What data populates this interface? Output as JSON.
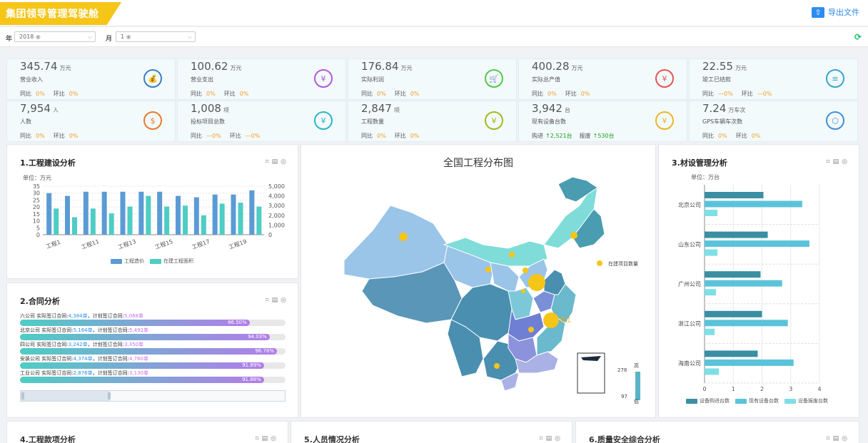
{
  "app": {
    "title": "集团领导管理驾驶舱",
    "export_label": "导出文件"
  },
  "filters": {
    "year_label": "年",
    "year_value": "2018",
    "month_label": "月",
    "month_value": "1"
  },
  "kpis": [
    {
      "value": "345.74",
      "unit": "万元",
      "label": "营业收入",
      "yoy_label": "同比",
      "yoy": "0%",
      "mom_label": "环比",
      "mom": "0%",
      "icon": "money-bag-icon",
      "color": "#3a7fc4"
    },
    {
      "value": "100.62",
      "unit": "万元",
      "label": "营业支出",
      "yoy_label": "同比",
      "yoy": "0%",
      "mom_label": "环比",
      "mom": "0%",
      "icon": "yen-circle-icon",
      "color": "#b25ad6"
    },
    {
      "value": "176.84",
      "unit": "万元",
      "label": "实际利润",
      "yoy_label": "同比",
      "yoy": "0%",
      "mom_label": "环比",
      "mom": "0%",
      "icon": "cart-icon",
      "color": "#55c94a"
    },
    {
      "value": "400.28",
      "unit": "万元",
      "label": "实际总产值",
      "yoy_label": "同比",
      "yoy": "0%",
      "mom_label": "环比",
      "mom": "0%",
      "icon": "banknote-icon",
      "color": "#e4554f"
    },
    {
      "value": "22.55",
      "unit": "万元",
      "label": "竣工已结款",
      "yoy_label": "同比",
      "yoy": "—0%",
      "mom_label": "环比",
      "mom": "—0%",
      "icon": "clipboard-icon",
      "color": "#3aa6c9"
    },
    {
      "value": "7,954",
      "unit": "人",
      "label": "人数",
      "yoy_label": "同比",
      "yoy": "0%",
      "mom_label": "环比",
      "mom": "0%",
      "icon": "dollar-house-icon",
      "color": "#e87a2e"
    },
    {
      "value": "1,008",
      "unit": "项",
      "label": "投标项目总数",
      "yoy_label": "同比",
      "yoy": "—0%",
      "mom_label": "环比",
      "mom": "—0%",
      "icon": "tag-icon",
      "color": "#2bb5c9"
    },
    {
      "value": "2,847",
      "unit": "项",
      "label": "工程数量",
      "yoy_label": "同比",
      "yoy": "0%",
      "mom_label": "环比",
      "mom": "0%",
      "icon": "yen-bag-icon",
      "color": "#a5b81c"
    },
    {
      "value": "3,942",
      "unit": "台",
      "label": "现有设备台数",
      "yoy_label": "购进",
      "yoy": "2,521台",
      "mom_label": "报废",
      "mom": "530台",
      "icon": "yen-house-icon",
      "color": "#e9b52a"
    },
    {
      "value": "7.24",
      "unit": "万车次",
      "label": "GPS车辆车次数",
      "yoy_label": "同比",
      "yoy": "0%",
      "mom_label": "环比",
      "mom": "0%",
      "icon": "hexagon-network-icon",
      "color": "#3f8fd8"
    }
  ],
  "panels": {
    "construction": {
      "title": "1.工程建设分析",
      "unit": "单位：万元",
      "legend": [
        "工程造价",
        "在建工程面积"
      ]
    },
    "contract": {
      "title": "2.合同分析"
    },
    "map": {
      "title": "全国工程分布图",
      "legend_label": "在建项目数量",
      "high": "高",
      "low": "低",
      "max_value": "278",
      "min_value": "97",
      "city_label": "浙江"
    },
    "equipment": {
      "title": "3.材设管理分析",
      "unit": "单位：万台",
      "legend": [
        "设备购进台数",
        "现有设备台数",
        "设备报废台数"
      ]
    },
    "payment": {
      "title": "4.工程款项分析"
    },
    "personnel": {
      "title": "5.人员情况分析"
    },
    "quality": {
      "title": "6.质量安全综合分析"
    }
  },
  "contracts": [
    {
      "company": "六公司",
      "actual_label": "实际签订合同:",
      "actual": "4,384单",
      "plan_label": "计划签订合同:",
      "plan": "5,068单",
      "pct": "86.50%",
      "ratio": 0.865
    },
    {
      "company": "北京公司",
      "actual_label": "实际签订合同:",
      "actual": "5,164单",
      "plan_label": "计划签订合同:",
      "plan": "5,492单",
      "pct": "94.03%",
      "ratio": 0.9403
    },
    {
      "company": "四公司",
      "actual_label": "实际签订合同:",
      "actual": "3,242单",
      "plan_label": "计划签订合同:",
      "plan": "3,350单",
      "pct": "96.78%",
      "ratio": 0.9678
    },
    {
      "company": "安装公司",
      "actual_label": "实际签订合同:",
      "actual": "4,374单",
      "plan_label": "计划签订合同:",
      "plan": "4,760单",
      "pct": "91.89%",
      "ratio": 0.9189
    },
    {
      "company": "工业公司",
      "actual_label": "实际签订合同:",
      "actual": "2,876单",
      "plan_label": "计划签订合同:",
      "plan": "3,130单",
      "pct": "91.88%",
      "ratio": 0.9188
    }
  ],
  "chart_data": [
    {
      "type": "bar",
      "x_tick_labels": [
        "工程1",
        "工程11",
        "工程13",
        "工程15",
        "工程17",
        "工程19"
      ],
      "series": [
        {
          "name": "工程造价",
          "axis": "left",
          "values": [
            30,
            28,
            31,
            31,
            31,
            31,
            31,
            28,
            27,
            29,
            29,
            32
          ],
          "color": "#5b9bd5"
        },
        {
          "name": "在建工程面积",
          "axis": "right",
          "values": [
            2700,
            1800,
            2700,
            2200,
            2900,
            4000,
            2900,
            3000,
            2000,
            3200,
            3300,
            2900
          ],
          "color": "#4ecdc4"
        }
      ],
      "ylim_left": [
        0,
        35
      ],
      "ytick_left": [
        0,
        5,
        10,
        15,
        20,
        25,
        30,
        35
      ],
      "ylim_right": [
        0,
        5000
      ],
      "ytick_right": [
        "0",
        "1,000",
        "2,000",
        "3,000",
        "4,000",
        "5,000"
      ]
    },
    {
      "type": "bar",
      "orientation": "horizontal",
      "categories": [
        "北京公司",
        "山东公司",
        "广州公司",
        "浙江公司",
        "海南公司"
      ],
      "series": [
        {
          "name": "设备购进台数",
          "values": [
            2.05,
            2.2,
            1.95,
            2.0,
            1.85
          ],
          "color": "#3a8fa3"
        },
        {
          "name": "现有设备台数",
          "values": [
            3.4,
            3.65,
            2.7,
            2.9,
            3.1
          ],
          "color": "#5bc3d9"
        },
        {
          "name": "设备报废台数",
          "values": [
            0.45,
            0.45,
            0.4,
            0.35,
            0.5
          ],
          "color": "#7ee0e6"
        }
      ],
      "xlim": [
        0,
        4
      ],
      "xticks": [
        0,
        1,
        2,
        3,
        4
      ]
    }
  ]
}
